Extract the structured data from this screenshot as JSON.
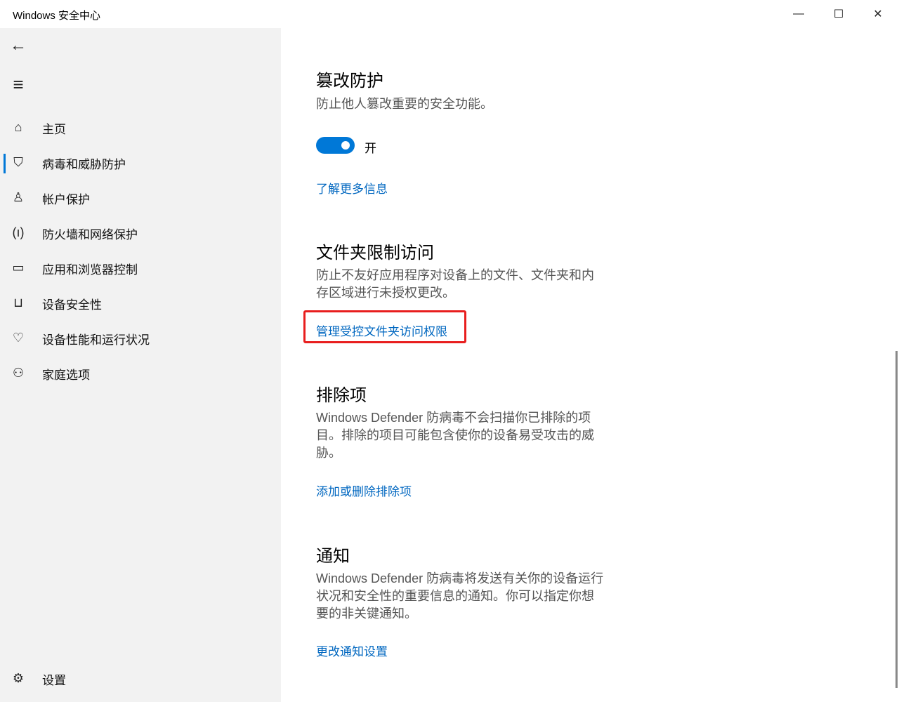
{
  "window": {
    "title": "Windows 安全中心",
    "minimize": "—",
    "maximize": "☐",
    "close": "✕"
  },
  "sidebar": {
    "back_icon": "←",
    "menu_icon": "≡",
    "items": [
      {
        "label": "主页",
        "icon": "home-icon",
        "glyph": "⌂"
      },
      {
        "label": "病毒和威胁防护",
        "icon": "shield-icon",
        "glyph": "⛉",
        "selected": true
      },
      {
        "label": "帐户保护",
        "icon": "person-icon",
        "glyph": "♙"
      },
      {
        "label": "防火墙和网络保护",
        "icon": "wireless-icon",
        "glyph": "(ı)"
      },
      {
        "label": "应用和浏览器控制",
        "icon": "browser-icon",
        "glyph": "▭"
      },
      {
        "label": "设备安全性",
        "icon": "laptop-icon",
        "glyph": "⊔"
      },
      {
        "label": "设备性能和运行状况",
        "icon": "heart-icon",
        "glyph": "♡"
      },
      {
        "label": "家庭选项",
        "icon": "family-icon",
        "glyph": "⚇"
      }
    ],
    "settings": {
      "label": "设置",
      "glyph": "⚙"
    },
    "accent": "#0078d7"
  },
  "sections": {
    "tamper": {
      "title": "篡改防护",
      "desc": "防止他人篡改重要的安全功能。",
      "toggle_state": "开",
      "toggle_on": true,
      "link": "了解更多信息"
    },
    "cfa": {
      "title": "文件夹限制访问",
      "desc": "防止不友好应用程序对设备上的文件、文件夹和内存区域进行未授权更改。",
      "link": "管理受控文件夹访问权限"
    },
    "exclusions": {
      "title": "排除项",
      "desc": "Windows Defender 防病毒不会扫描你已排除的项目。排除的项目可能包含使你的设备易受攻击的威胁。",
      "link": "添加或删除排除项"
    },
    "notifications": {
      "title": "通知",
      "desc": "Windows Defender 防病毒将发送有关你的设备运行状况和安全性的重要信息的通知。你可以指定你想要的非关键通知。",
      "link": "更改通知设置"
    }
  }
}
